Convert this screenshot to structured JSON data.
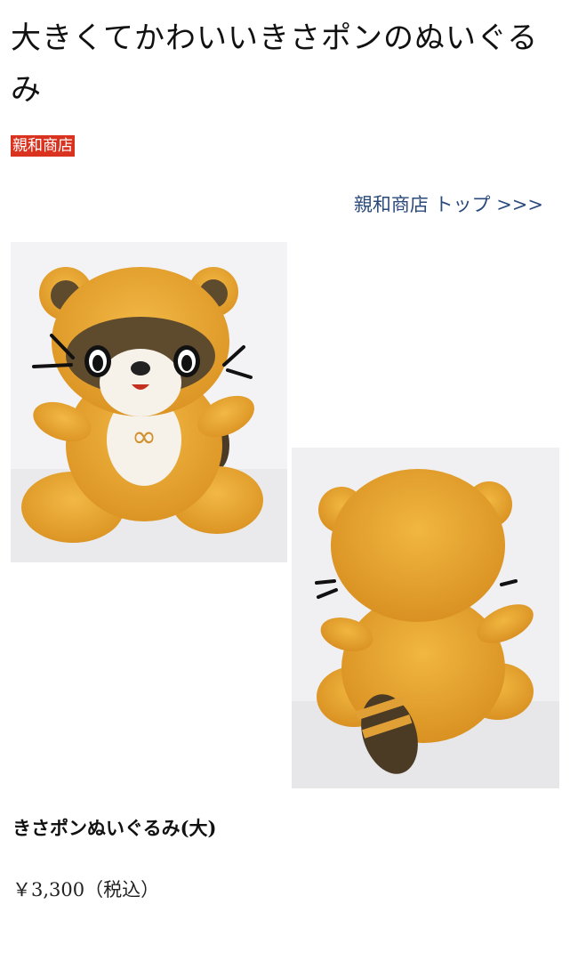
{
  "page": {
    "title": "大きくてかわいいきさポンのぬいぐるみ",
    "shop_badge": "親和商店",
    "top_link": "親和商店 トップ >>>"
  },
  "images": [
    {
      "name": "plush-front-photo",
      "subject": "きさポン plush, front view"
    },
    {
      "name": "plush-back-photo",
      "subject": "きさポン plush, back view"
    }
  ],
  "product": {
    "name": "きさポンぬいぐるみ(大)",
    "price": "￥3,300（税込）"
  },
  "colors": {
    "badge_bg": "#d9321e",
    "link": "#2a4a7c",
    "plush_orange": "#e9a833",
    "plush_brown": "#5e4a2c"
  }
}
